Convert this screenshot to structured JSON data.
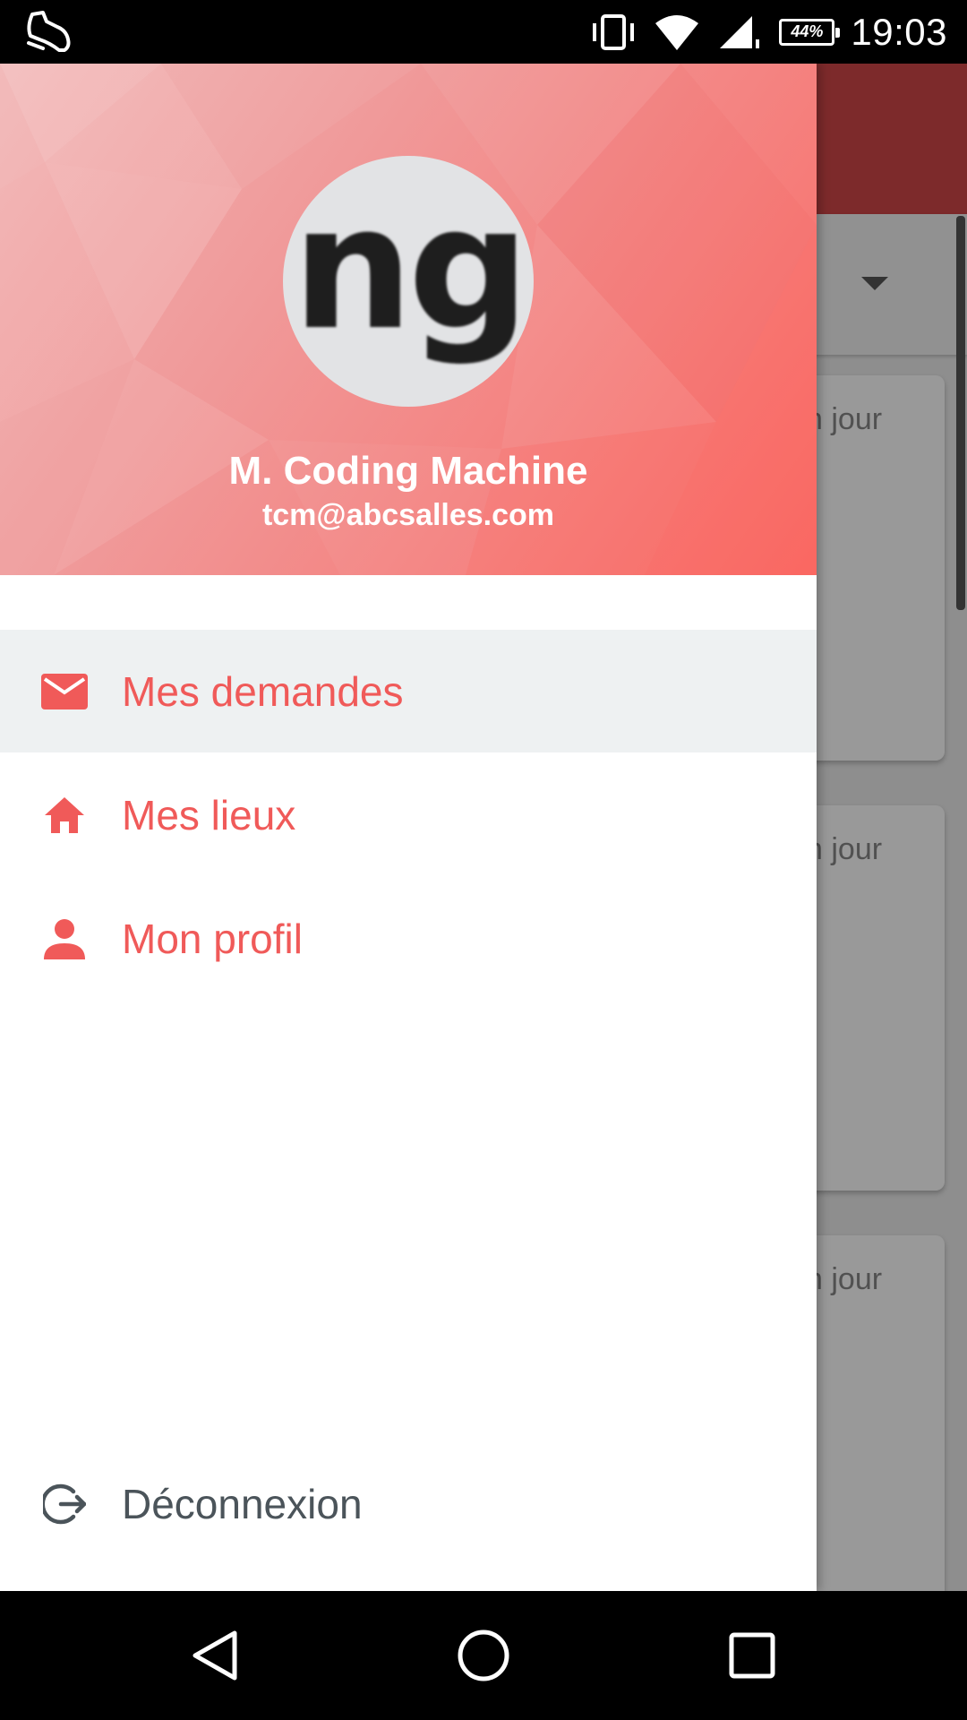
{
  "status_bar": {
    "time": "19:03",
    "battery": "44%",
    "icons": [
      "notification-shoe-icon",
      "vibrate-icon",
      "wifi-icon",
      "cell-signal-icon",
      "battery-icon"
    ]
  },
  "background": {
    "card_text": "n jour",
    "toolbar_color": "#d04648"
  },
  "drawer": {
    "header": {
      "avatar_text": "ng",
      "user_name": "M. Coding Machine",
      "user_email": "tcm@abcsalles.com"
    },
    "items": [
      {
        "label": "Mes demandes",
        "icon": "mail-icon",
        "active": true
      },
      {
        "label": "Mes lieux",
        "icon": "home-icon",
        "active": false
      },
      {
        "label": "Mon profil",
        "icon": "person-icon",
        "active": false
      }
    ],
    "logout": {
      "label": "Déconnexion",
      "icon": "logout-icon"
    }
  },
  "colors": {
    "accent": "#f05a59",
    "active_bg": "#eef1f2",
    "logout_text": "#4b545a"
  },
  "nav_bar": {
    "icons": [
      "back-icon",
      "home-circle-icon",
      "recents-icon"
    ]
  }
}
